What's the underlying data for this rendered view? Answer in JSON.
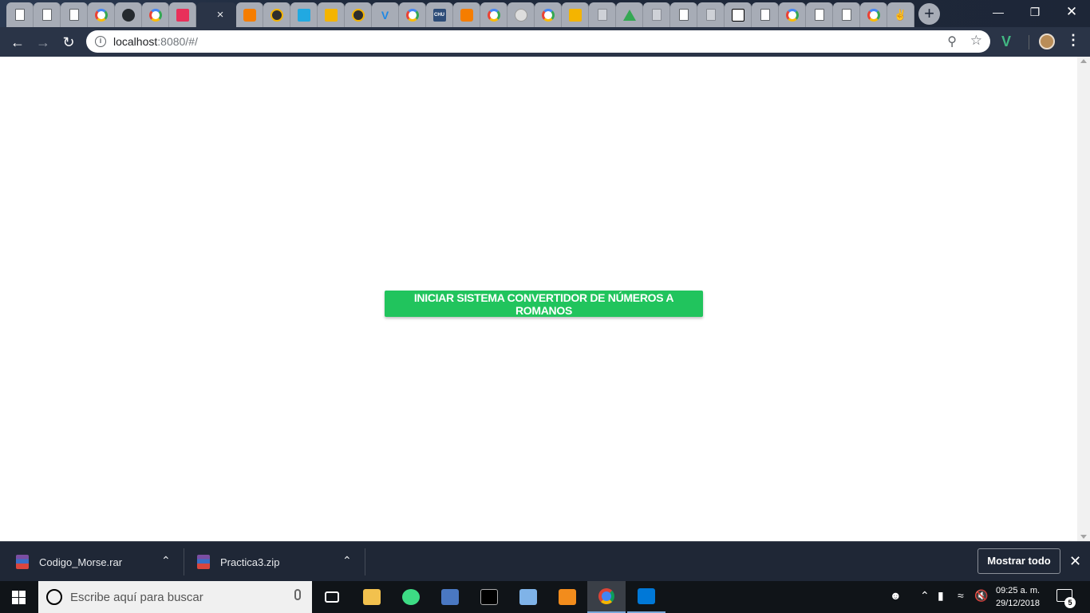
{
  "browser": {
    "url_host": "localhost",
    "url_rest": ":8080/#/",
    "tab_close_glyph": "×",
    "new_tab_glyph": "+"
  },
  "page": {
    "start_button_label": "INICIAR SISTEMA CONVERTIDOR DE NÚMEROS A ROMANOS",
    "accent_color": "#21c45d"
  },
  "downloads": {
    "items": [
      {
        "name": "Codigo_Morse.rar"
      },
      {
        "name": "Practica3.zip"
      }
    ],
    "show_all_label": "Mostrar todo"
  },
  "taskbar": {
    "search_placeholder": "Escribe aquí para buscar",
    "time": "09:25 a. m.",
    "date": "29/12/2018",
    "notification_count": "5"
  }
}
